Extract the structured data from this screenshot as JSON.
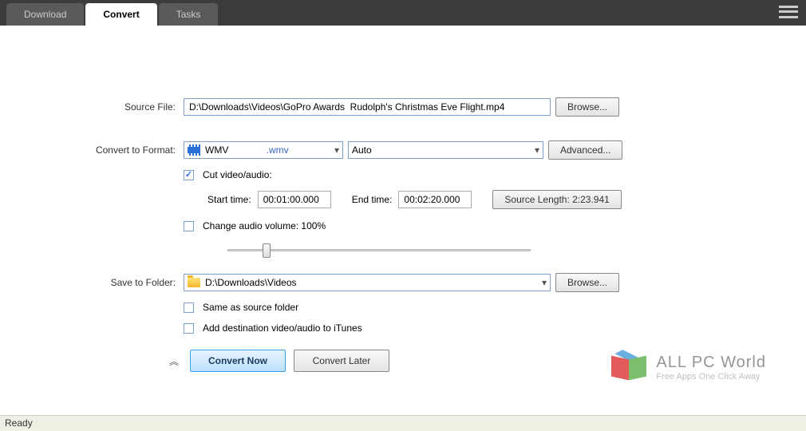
{
  "tabs": {
    "download": "Download",
    "convert": "Convert",
    "tasks": "Tasks"
  },
  "labels": {
    "source_file": "Source File:",
    "convert_to": "Convert to Format:",
    "cut": "Cut video/audio:",
    "start": "Start time:",
    "end": "End time:",
    "source_len": "Source Length: 2:23.941",
    "change_vol": "Change audio volume: 100%",
    "save_to": "Save to Folder:",
    "same_folder": "Same as source folder",
    "add_itunes": "Add destination video/audio to iTunes"
  },
  "fields": {
    "source_path": "D:\\Downloads\\Videos\\GoPro Awards  Rudolph's Christmas Eve Flight.mp4",
    "format": "WMV",
    "format_ext": ".wmv",
    "auto": "Auto",
    "start_time": "00:01:00.000",
    "end_time": "00:02:20.000",
    "save_path": "D:\\Downloads\\Videos"
  },
  "buttons": {
    "browse": "Browse...",
    "advanced": "Advanced...",
    "convert_now": "Convert Now",
    "convert_later": "Convert Later"
  },
  "status": "Ready",
  "watermark": {
    "title": "ALL PC World",
    "sub": "Free Apps One Click Away"
  }
}
